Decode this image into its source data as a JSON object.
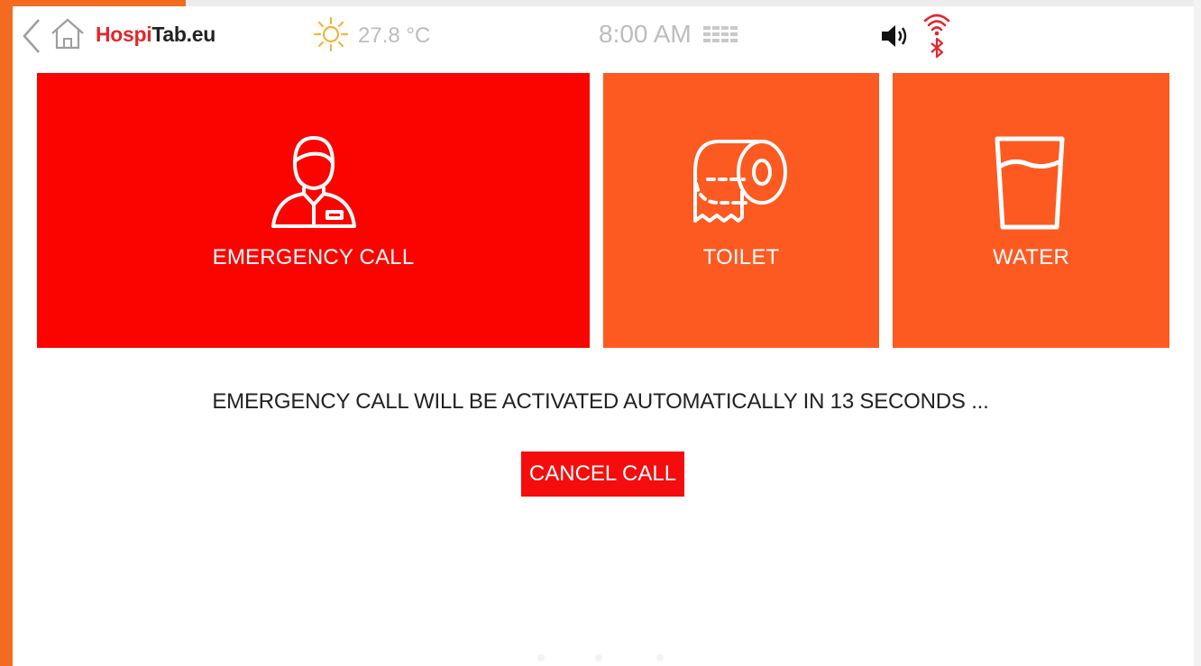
{
  "statusbar": {
    "brand_accent": "Hospi",
    "brand_rest": "Tab.eu",
    "temperature": "27.8 °C",
    "time": "8:00 AM",
    "icons": [
      "back-icon",
      "home-icon",
      "sun-icon",
      "volume-icon",
      "wifi-icon",
      "bluetooth-icon"
    ]
  },
  "tiles": [
    {
      "label": "EMERGENCY CALL",
      "icon": "nurse-icon",
      "color": "#fb0400"
    },
    {
      "label": "TOILET",
      "icon": "toilet-paper-icon",
      "color": "#fd5a22"
    },
    {
      "label": "WATER",
      "icon": "water-glass-icon",
      "color": "#fd5a22"
    }
  ],
  "countdown": {
    "message": "EMERGENCY CALL WILL BE ACTIVATED AUTOMATICALLY IN 13 SECONDS ..."
  },
  "actions": {
    "cancel_label": "CANCEL CALL"
  },
  "colors": {
    "frame": "#f26b21",
    "brand_accent": "#e3262b",
    "emergency": "#fb0400",
    "tile_orange": "#fd5a22",
    "cancel": "#f50d0d"
  }
}
